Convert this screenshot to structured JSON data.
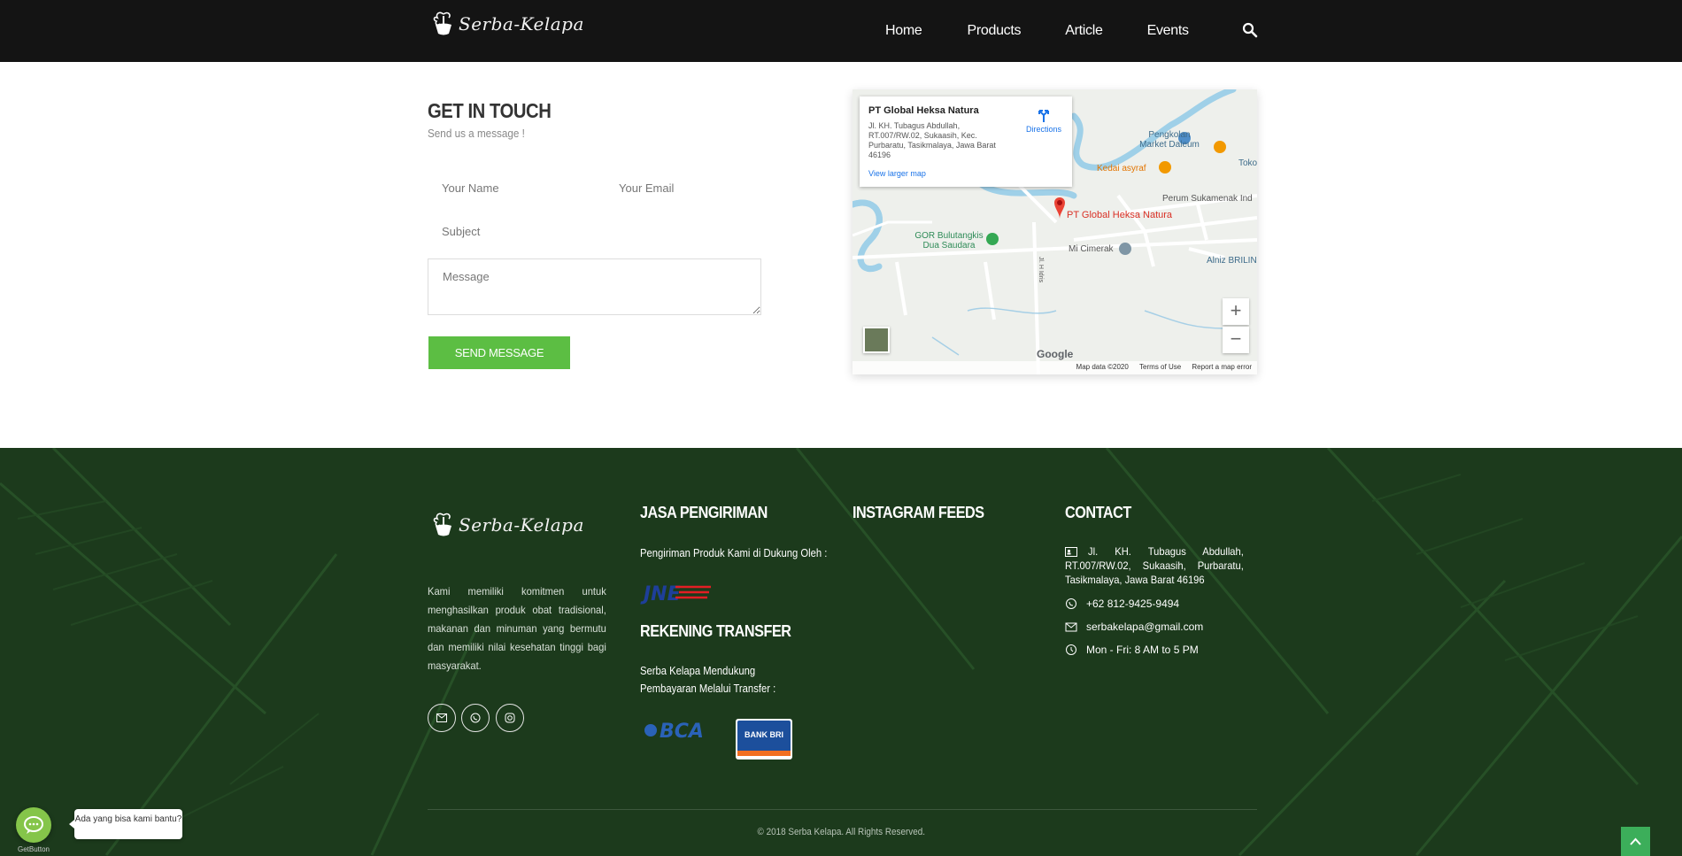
{
  "header": {
    "logo_text": "Serba-Kelapa",
    "nav": [
      "Home",
      "Products",
      "Article",
      "Events"
    ]
  },
  "contact_form": {
    "title": "GET IN TOUCH",
    "subtitle": "Send us a message !",
    "name_placeholder": "Your Name",
    "email_placeholder": "Your Email",
    "subject_placeholder": "Subject",
    "message_placeholder": "Message",
    "send_label": "SEND MESSAGE"
  },
  "map": {
    "place_name": "PT Global Heksa Natura",
    "address": "Jl. KH. Tubagus Abdullah, RT.007/RW.02, Sukaasih, Kec. Purbaratu, Tasikmalaya, Jawa Barat 46196",
    "directions_label": "Directions",
    "larger_map_label": "View larger map",
    "pin_label": "PT Global Heksa Natura",
    "pois": [
      "Pengkolan Market Daleum",
      "Kedai asyraf",
      "Toko",
      "Perum Sukamenak Ind",
      "GOR Bulutangkis Dua Saudara",
      "Mi Cimerak",
      "Alniz BRILIN"
    ],
    "road_label": "Jl. H Idris",
    "google_label": "Google",
    "attribution": [
      "Map data ©2020",
      "Terms of Use",
      "Report a map error"
    ],
    "zoom_in": "+",
    "zoom_out": "−"
  },
  "footer": {
    "logo_text": "Serba-Kelapa",
    "about": "Kami memiliki komitmen untuk menghasilkan produk obat tradisional, makanan dan minuman yang bermutu dan memiliki nilai kesehatan tinggi bagi masyarakat.",
    "shipping_title": "JASA PENGIRIMAN",
    "shipping_text": "Pengiriman Produk Kami di Dukung Oleh :",
    "shipping_logo": "JNE",
    "transfer_title": "REKENING TRANSFER",
    "transfer_text": "Serba Kelapa Mendukung Pembayaran Melalui Transfer :",
    "bank_1": "BCA",
    "bank_2": "BANK BRI",
    "instagram_title": "INSTAGRAM FEEDS",
    "contact_title": "CONTACT",
    "contact_address": "Jl. KH. Tubagus Abdullah, RT.007/RW.02, Sukaasih, Purbaratu, Tasikmalaya, Jawa Barat 46196",
    "phone": "+62 812-9425-9494",
    "email": "serbakelapa@gmail.com",
    "hours": "Mon - Fri: 8 AM to 5 PM",
    "copyright": "© 2018 Serba Kelapa. All Rights Reserved."
  },
  "chat_widget": {
    "bubble_text": "Ada yang bisa kami bantu?",
    "label": "GetButton"
  },
  "colors": {
    "header_bg": "#141414",
    "accent_green": "#5cbe43",
    "footer_bg": "#1d3d1d",
    "pin_red": "#d93025"
  }
}
